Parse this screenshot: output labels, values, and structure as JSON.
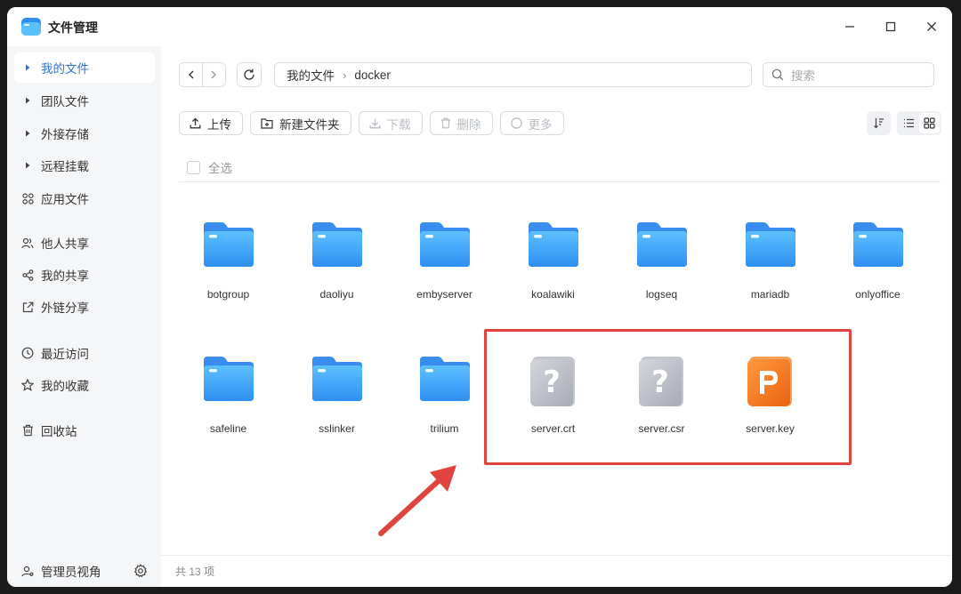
{
  "app": {
    "title": "文件管理"
  },
  "window_controls": [
    "minimize",
    "maximize",
    "close"
  ],
  "sidebar": {
    "items": [
      {
        "label": "我的文件",
        "icon": "caret-right-icon",
        "active": true
      },
      {
        "label": "团队文件",
        "icon": "caret-right-icon"
      },
      {
        "label": "外接存储",
        "icon": "caret-right-icon"
      },
      {
        "label": "远程挂载",
        "icon": "caret-right-icon"
      },
      {
        "label": "应用文件",
        "icon": "apps-icon"
      },
      {
        "label": "他人共享",
        "icon": "users-icon"
      },
      {
        "label": "我的共享",
        "icon": "share-icon"
      },
      {
        "label": "外链分享",
        "icon": "external-link-icon"
      },
      {
        "label": "最近访问",
        "icon": "clock-icon"
      },
      {
        "label": "我的收藏",
        "icon": "star-icon"
      },
      {
        "label": "回收站",
        "icon": "trash-icon"
      }
    ],
    "bottom": {
      "label": "管理员视角"
    }
  },
  "path": {
    "root": "我的文件",
    "current": "docker"
  },
  "search": {
    "placeholder": "搜索"
  },
  "toolbar": {
    "upload": "上传",
    "new_folder": "新建文件夹",
    "download": "下载",
    "delete": "删除",
    "more": "更多"
  },
  "select_all": "全选",
  "files": [
    {
      "name": "botgroup",
      "type": "folder"
    },
    {
      "name": "daoliyu",
      "type": "folder"
    },
    {
      "name": "embyserver",
      "type": "folder"
    },
    {
      "name": "koalawiki",
      "type": "folder"
    },
    {
      "name": "logseq",
      "type": "folder"
    },
    {
      "name": "mariadb",
      "type": "folder"
    },
    {
      "name": "onlyoffice",
      "type": "folder"
    },
    {
      "name": "safeline",
      "type": "folder"
    },
    {
      "name": "sslinker",
      "type": "folder"
    },
    {
      "name": "trilium",
      "type": "folder"
    },
    {
      "name": "server.crt",
      "type": "unknown"
    },
    {
      "name": "server.csr",
      "type": "unknown"
    },
    {
      "name": "server.key",
      "type": "key"
    }
  ],
  "status": {
    "count_text": "共 13 项"
  },
  "colors": {
    "accent": "#2f6fe0",
    "folder": "#3aa0f5",
    "highlight": "#e0443e",
    "key_file": "#f07a22"
  }
}
